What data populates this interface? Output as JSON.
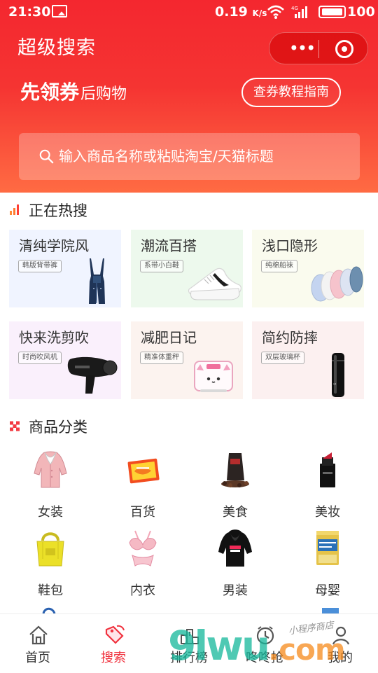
{
  "status_bar": {
    "time": "21:30",
    "speed": "0.19",
    "speed_unit": "K/s",
    "network": "4G",
    "battery": "100"
  },
  "header": {
    "app_title": "超级搜索",
    "coupon_bold": "先领券",
    "coupon_light": "后购物",
    "guide_button": "查券教程指南"
  },
  "search": {
    "placeholder": "输入商品名称或粘贴淘宝/天猫标题"
  },
  "hot_search": {
    "heading": "正在热搜",
    "cards": [
      {
        "title": "清纯学院风",
        "tag": "韩版背带裤",
        "icon": "overalls-icon",
        "background": "#f0f4ff"
      },
      {
        "title": "潮流百搭",
        "tag": "系带小白鞋",
        "icon": "sneaker-icon",
        "background": "#edf9ed"
      },
      {
        "title": "浅口隐形",
        "tag": "纯棉船袜",
        "icon": "socks-icon",
        "background": "#fafbee"
      },
      {
        "title": "快来洗剪吹",
        "tag": "时尚吹风机",
        "icon": "hair-dryer-icon",
        "background": "#faf0fc"
      },
      {
        "title": "减肥日记",
        "tag": "精准体重秤",
        "icon": "scale-icon",
        "background": "#fcf3ef"
      },
      {
        "title": "简约防摔",
        "tag": "双层玻璃杯",
        "icon": "glass-cup-icon",
        "background": "#fcf0f0"
      }
    ]
  },
  "categories": {
    "heading": "商品分类",
    "items": [
      {
        "label": "女装",
        "icon": "women-coat-icon"
      },
      {
        "label": "百货",
        "icon": "shopping-card-icon"
      },
      {
        "label": "美食",
        "icon": "coffee-beans-icon"
      },
      {
        "label": "美妆",
        "icon": "lipstick-icon"
      },
      {
        "label": "鞋包",
        "icon": "tote-bag-icon"
      },
      {
        "label": "内衣",
        "icon": "lingerie-icon"
      },
      {
        "label": "男装",
        "icon": "hoodie-icon"
      },
      {
        "label": "母婴",
        "icon": "formula-can-icon"
      }
    ]
  },
  "tabbar": {
    "items": [
      {
        "label": "首页",
        "icon": "home-icon",
        "active": false
      },
      {
        "label": "搜索",
        "icon": "tag-search-icon",
        "active": true
      },
      {
        "label": "排行榜",
        "icon": "podium-icon",
        "active": false
      },
      {
        "label": "咚咚抢",
        "icon": "alarm-clock-icon",
        "active": false
      },
      {
        "label": "我的",
        "icon": "user-icon",
        "active": false
      }
    ]
  },
  "watermark": {
    "logo": "9lwu",
    "domain": ".com",
    "tagline": "小程序商店"
  },
  "colors": {
    "brand_red": "#f4272f",
    "orange": "#ff6b43",
    "active_tab": "#f0333f"
  }
}
